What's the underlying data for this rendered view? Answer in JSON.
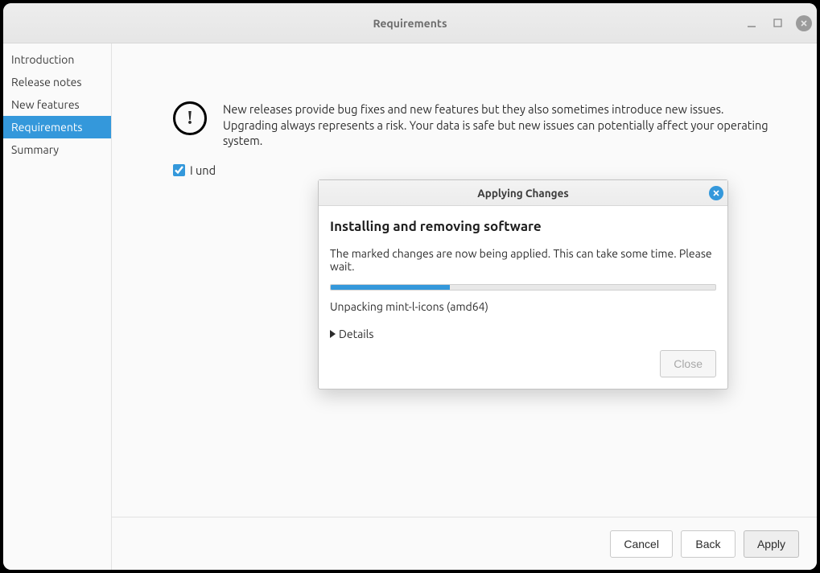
{
  "window": {
    "title": "Requirements"
  },
  "sidebar": {
    "items": [
      {
        "label": "Introduction"
      },
      {
        "label": "Release notes"
      },
      {
        "label": "New features"
      },
      {
        "label": "Requirements"
      },
      {
        "label": "Summary"
      }
    ],
    "active_index": 3
  },
  "main": {
    "warning_text": "New releases provide bug fixes and new features but they also sometimes introduce new issues. Upgrading always represents a risk. Your data is safe but new issues can potentially affect your operating system.",
    "ack_label_visible": "I und",
    "ack_checked": true
  },
  "footer": {
    "cancel": "Cancel",
    "back": "Back",
    "apply": "Apply"
  },
  "modal": {
    "header": "Applying Changes",
    "title": "Installing and removing software",
    "description": "The marked changes are now being applied. This can take some time. Please wait.",
    "progress_percent": 31,
    "status": "Unpacking mint-l-icons (amd64)",
    "details_label": "Details",
    "close_label": "Close",
    "close_enabled": false
  },
  "colors": {
    "accent": "#3498db"
  }
}
